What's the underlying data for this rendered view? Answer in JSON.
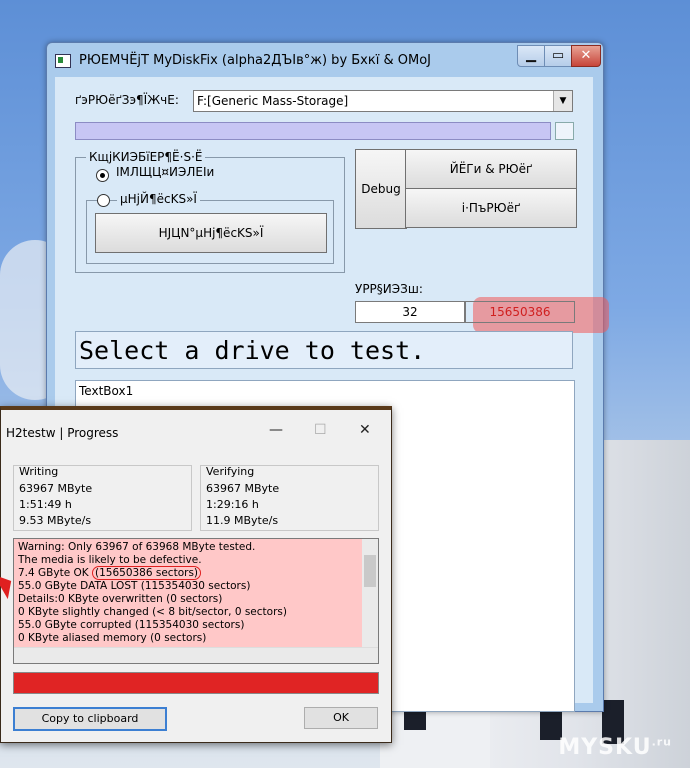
{
  "main_window": {
    "title": "РЮЕМЧЁјТ MyDiskFix (alpha2ДЪІв°ж) by Бхкї & OMoJ",
    "drive_label": "ґэРЮёґЗэ¶ЇЖчЕ:",
    "drive_value": "F:[Generic Mass-Storage]",
    "group_title": "КщјКИЭБїЕР¶Ё·S·Ё",
    "radio1_label": "ІМЛЩЦ¤ИЭЛЕІи",
    "radio2_label": "µНјЙ¶ёcKS»Ї",
    "scan_button": "НЈЦN°µНј¶ёcKS»Ї",
    "debug_button": "Debug",
    "start_button": "ЙЁГи & РЮёґ",
    "stop_button": "і·ПъРЮёґ",
    "sector_label": "УРР§ИЭЗш:",
    "sector_start": "32",
    "sector_end": "15650386",
    "status_text": "Select a drive to test.",
    "textbox_text": "TextBox1"
  },
  "h2testw": {
    "title": "H2testw | Progress",
    "writing": {
      "header": "Writing",
      "size": "63967 MByte",
      "time": "1:51:49 h",
      "speed": "9.53 MByte/s"
    },
    "verifying": {
      "header": "Verifying",
      "size": "63967 MByte",
      "time": "1:29:16 h",
      "speed": "11.9 MByte/s"
    },
    "log": {
      "l1": "Warning: Only 63967 of 63968 MByte tested.",
      "l2": "The media is likely to be defective.",
      "l3a": "7.4 GByte OK ",
      "l3b": "(15650386 sectors)",
      "l4": "55.0 GByte DATA LOST (115354030 sectors)",
      "l5": "Details:0 KByte overwritten (0 sectors)",
      "l6": "0 KByte slightly changed (< 8 bit/sector, 0 sectors)",
      "l7": "55.0 GByte corrupted (115354030 sectors)",
      "l8": "0 KByte aliased memory (0 sectors)"
    },
    "copy_button": "Copy to clipboard",
    "ok_button": "OK"
  },
  "watermark": {
    "main": "MYSKU",
    "sup": ".ru"
  },
  "colors": {
    "progress_red": "#e02424",
    "log_bg": "#ffc8c8",
    "highlight": "#f05a5a"
  }
}
